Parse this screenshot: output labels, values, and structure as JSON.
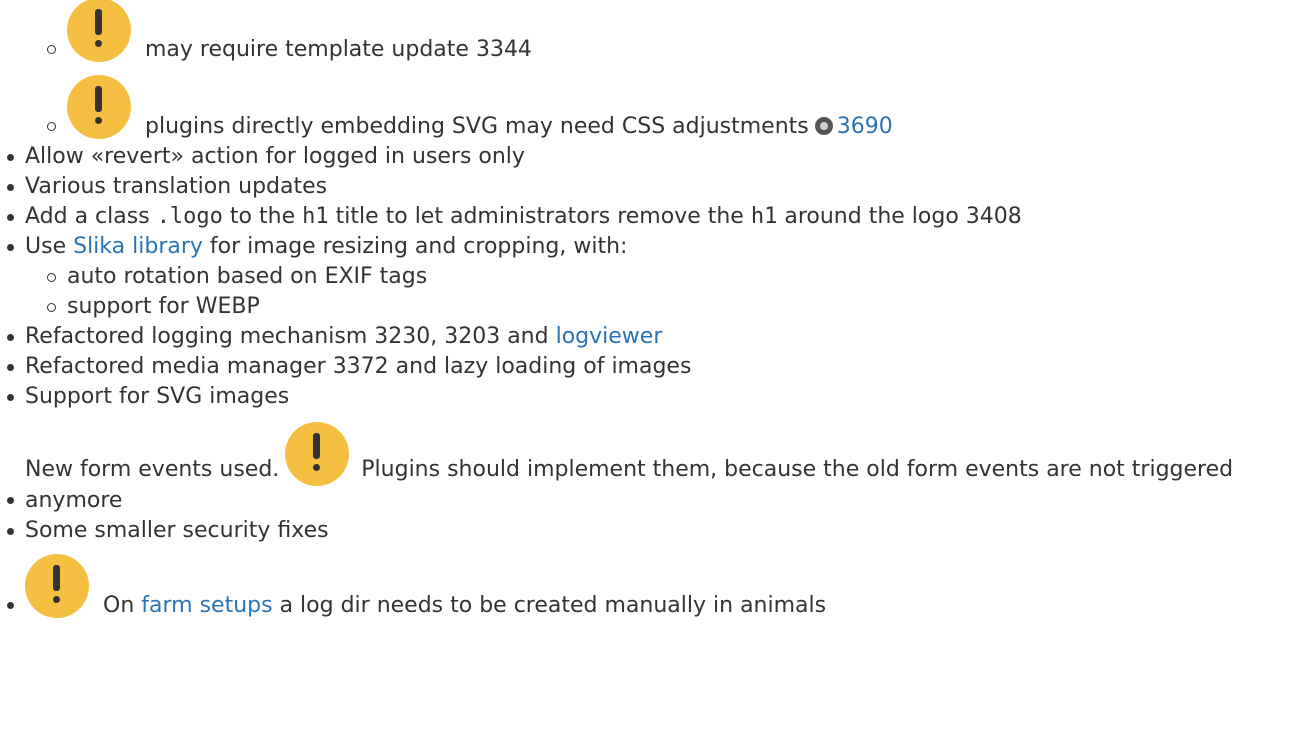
{
  "nested_top": [
    {
      "text": "may require template update 3344"
    },
    {
      "text": "plugins directly embedding SVG may need CSS adjustments",
      "link": "3690"
    }
  ],
  "items": {
    "revert": "Allow «revert» action for logged in users only",
    "translation": "Various translation updates",
    "logo_pre": "Add a class",
    "logo_code1": ".logo",
    "logo_mid1": "to the",
    "logo_code2": "h1",
    "logo_mid2": "title to let administrators remove the",
    "logo_code3": "h1",
    "logo_post": "around the logo 3408",
    "slika_pre": "Use",
    "slika_link": "Slika library",
    "slika_post": "for image resizing and cropping, with:",
    "slika_sub": [
      "auto rotation based on EXIF tags",
      "support for WEBP"
    ],
    "logging_pre": "Refactored logging mechanism 3230, 3203 and",
    "logging_link": "logviewer",
    "media": "Refactored media manager 3372 and lazy loading of images",
    "svg": "Support for SVG images",
    "form_pre": "New form events used.",
    "form_post": "Plugins should implement them, because the old form events are not triggered anymore",
    "security": "Some smaller security fixes",
    "farm_pre": "On",
    "farm_link": "farm setups",
    "farm_post": "a log dir needs to be created manually in animals"
  },
  "icons": {
    "warning": "warning-icon",
    "github": "github-icon"
  },
  "colors": {
    "warning": "#f5bf42",
    "link": "#2b73b7",
    "text": "#333333"
  }
}
